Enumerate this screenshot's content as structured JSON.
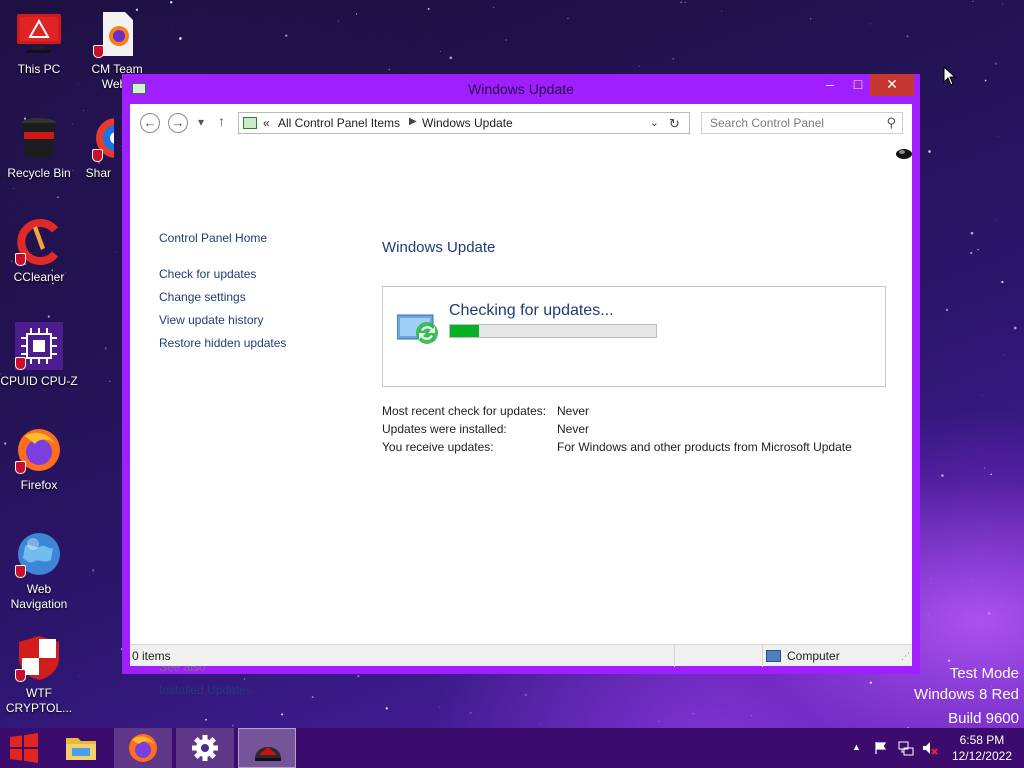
{
  "desktop": {
    "icons": [
      {
        "label": "This PC"
      },
      {
        "label": "CM Team Webs"
      },
      {
        "label": "Recycle Bin"
      },
      {
        "label": "Shar"
      },
      {
        "label": "CCleaner"
      },
      {
        "label": "CPUID CPU-Z"
      },
      {
        "label": "Firefox"
      },
      {
        "label": "Web Navigation"
      },
      {
        "label": "WTF CRYPTOL..."
      }
    ]
  },
  "window": {
    "title": "Windows Update",
    "controls": {
      "minimize": "–",
      "maximize": "□",
      "close": "✕"
    }
  },
  "navbar": {
    "back_icon": "←",
    "forward_icon": "→",
    "recent_icon": "▾",
    "up_icon": "↑",
    "breadcrumb": [
      "All Control Panel Items",
      "Windows Update"
    ],
    "breadcrumb_overflow": "«",
    "search_placeholder": "Search Control Panel"
  },
  "left_pane": {
    "home": "Control Panel Home",
    "links": [
      "Check for updates",
      "Change settings",
      "View update history",
      "Restore hidden updates"
    ],
    "see_also_title": "See also",
    "see_also_links": [
      "Installed Updates"
    ]
  },
  "main": {
    "title": "Windows Update",
    "status": "Checking for updates...",
    "progress": 0.14,
    "info": [
      {
        "label": "Most recent check for updates:",
        "value": "Never"
      },
      {
        "label": "Updates were installed:",
        "value": "Never"
      },
      {
        "label": "You receive updates:",
        "value": "For Windows and other products from Microsoft Update"
      }
    ]
  },
  "statusbar": {
    "items": "0 items",
    "location": "Computer"
  },
  "watermark": {
    "line1": "Test Mode",
    "line2": "Windows 8 Red",
    "line3": "Build 9600"
  },
  "taskbar": {
    "clock_time": "6:58 PM",
    "clock_date": "12/12/2022",
    "tray_overflow": "▲"
  },
  "colors": {
    "window_frame": "#9f1fff",
    "taskbar": "#3b0b6e",
    "link": "#1f3c78",
    "progress_fill": "#06b025",
    "close_button": "#c7372f"
  }
}
